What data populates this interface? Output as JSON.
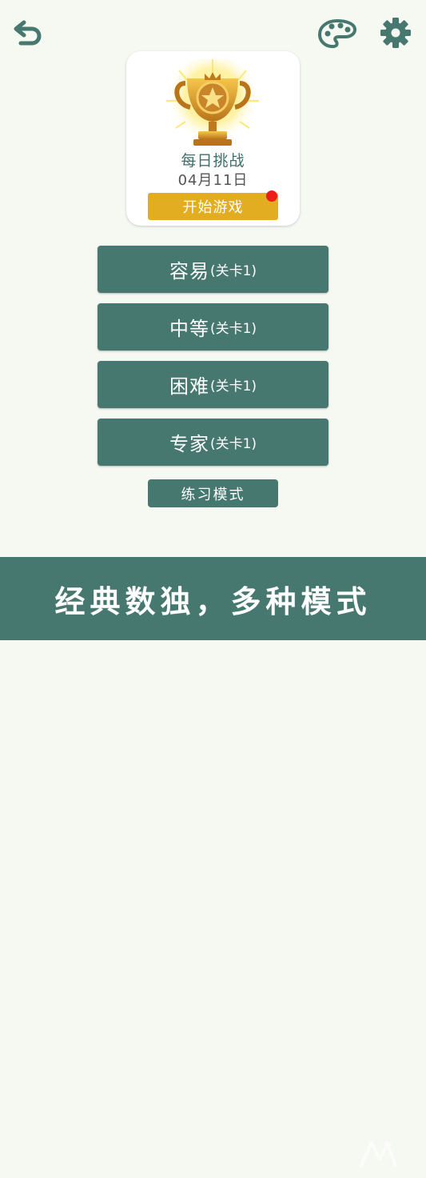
{
  "colors": {
    "accent": "#46786f",
    "gold": "#e2ad20",
    "notification": "#ee1b1b",
    "background": "#f6f8f2"
  },
  "icons": {
    "back": "back-arrow-icon",
    "palette": "palette-icon",
    "settings": "gear-icon",
    "trophy": "trophy-icon"
  },
  "daily_challenge": {
    "title": "每日挑战",
    "date": "04月11日",
    "start_label": "开始游戏"
  },
  "levels": [
    {
      "label": "容易",
      "sub": "(关卡1)"
    },
    {
      "label": "中等",
      "sub": "(关卡1)"
    },
    {
      "label": "困难",
      "sub": "(关卡1)"
    },
    {
      "label": "专家",
      "sub": "(关卡1)"
    }
  ],
  "practice_label": "练习模式",
  "banner_text": "经典数独，多种模式"
}
